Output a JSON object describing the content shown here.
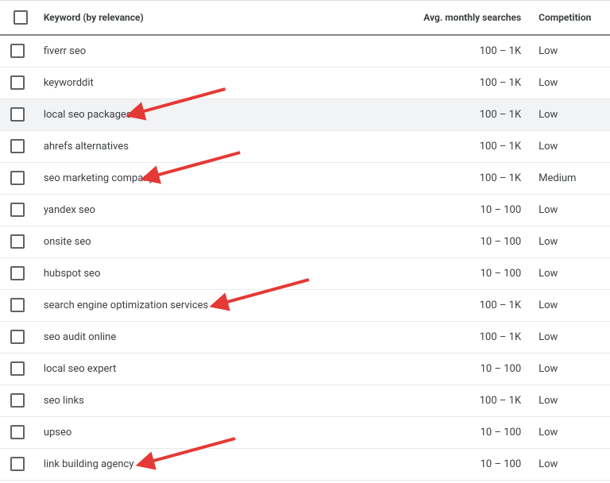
{
  "headers": {
    "keyword": "Keyword (by relevance)",
    "searches": "Avg. monthly searches",
    "competition": "Competition"
  },
  "rows": [
    {
      "keyword": "fiverr seo",
      "searches": "100 – 1K",
      "competition": "Low",
      "highlight": false,
      "arrow": false
    },
    {
      "keyword": "keyworddit",
      "searches": "100 – 1K",
      "competition": "Low",
      "highlight": false,
      "arrow": false
    },
    {
      "keyword": "local seo packages",
      "searches": "100 – 1K",
      "competition": "Low",
      "highlight": true,
      "arrow": true
    },
    {
      "keyword": "ahrefs alternatives",
      "searches": "100 – 1K",
      "competition": "Low",
      "highlight": false,
      "arrow": false
    },
    {
      "keyword": "seo marketing company",
      "searches": "100 – 1K",
      "competition": "Medium",
      "highlight": false,
      "arrow": true
    },
    {
      "keyword": "yandex seo",
      "searches": "10 – 100",
      "competition": "Low",
      "highlight": false,
      "arrow": false
    },
    {
      "keyword": "onsite seo",
      "searches": "10 – 100",
      "competition": "Low",
      "highlight": false,
      "arrow": false
    },
    {
      "keyword": "hubspot seo",
      "searches": "10 – 100",
      "competition": "Low",
      "highlight": false,
      "arrow": false
    },
    {
      "keyword": "search engine optimization services",
      "searches": "100 – 1K",
      "competition": "Low",
      "highlight": false,
      "arrow": true
    },
    {
      "keyword": "seo audit online",
      "searches": "100 – 1K",
      "competition": "Low",
      "highlight": false,
      "arrow": false
    },
    {
      "keyword": "local seo expert",
      "searches": "10 – 100",
      "competition": "Low",
      "highlight": false,
      "arrow": false
    },
    {
      "keyword": "seo links",
      "searches": "100 – 1K",
      "competition": "Low",
      "highlight": false,
      "arrow": false
    },
    {
      "keyword": "upseo",
      "searches": "10 – 100",
      "competition": "Low",
      "highlight": false,
      "arrow": false
    },
    {
      "keyword": "link building agency",
      "searches": "10 – 100",
      "competition": "Low",
      "highlight": false,
      "arrow": true
    }
  ],
  "colors": {
    "arrow": "#e53935"
  }
}
